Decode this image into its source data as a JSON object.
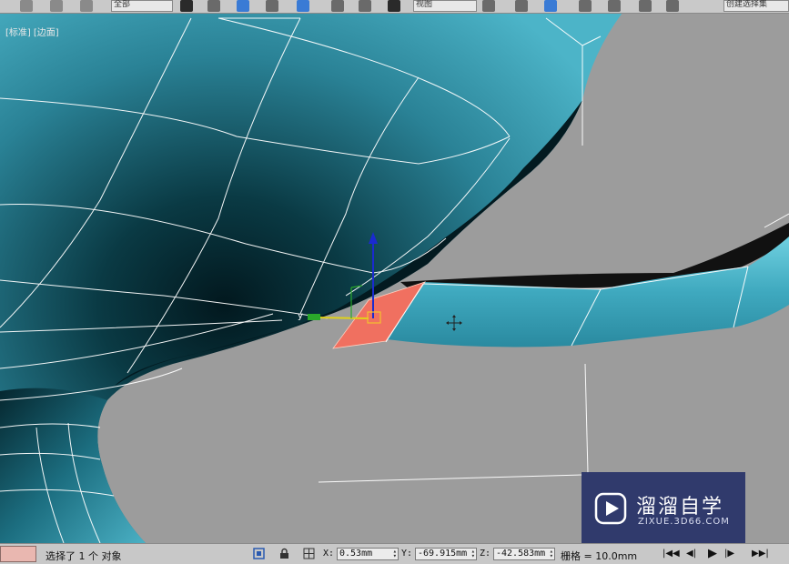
{
  "toolbar": {
    "selection_filter": "全部",
    "ref_coord": "视图",
    "named_set": "创建选择集"
  },
  "viewport": {
    "label_view": "[标准]",
    "label_shading": "[边面]"
  },
  "status": {
    "message": "选择了 1 个 对象",
    "x_label": "X:",
    "x_value": "0.53mm",
    "y_label": "Y:",
    "y_value": "-69.915mm",
    "z_label": "Z:",
    "z_value": "-42.583mm",
    "grid": "栅格 = 10.0mm"
  },
  "watermark": {
    "title": "溜溜自学",
    "subtitle": "ZIXUE.3D66.COM"
  },
  "colors": {
    "mesh": "#3aa3ba",
    "mesh_dark": "#072a33",
    "selected_face": "#f07060",
    "viewport_bg": "#9c9c9c"
  }
}
